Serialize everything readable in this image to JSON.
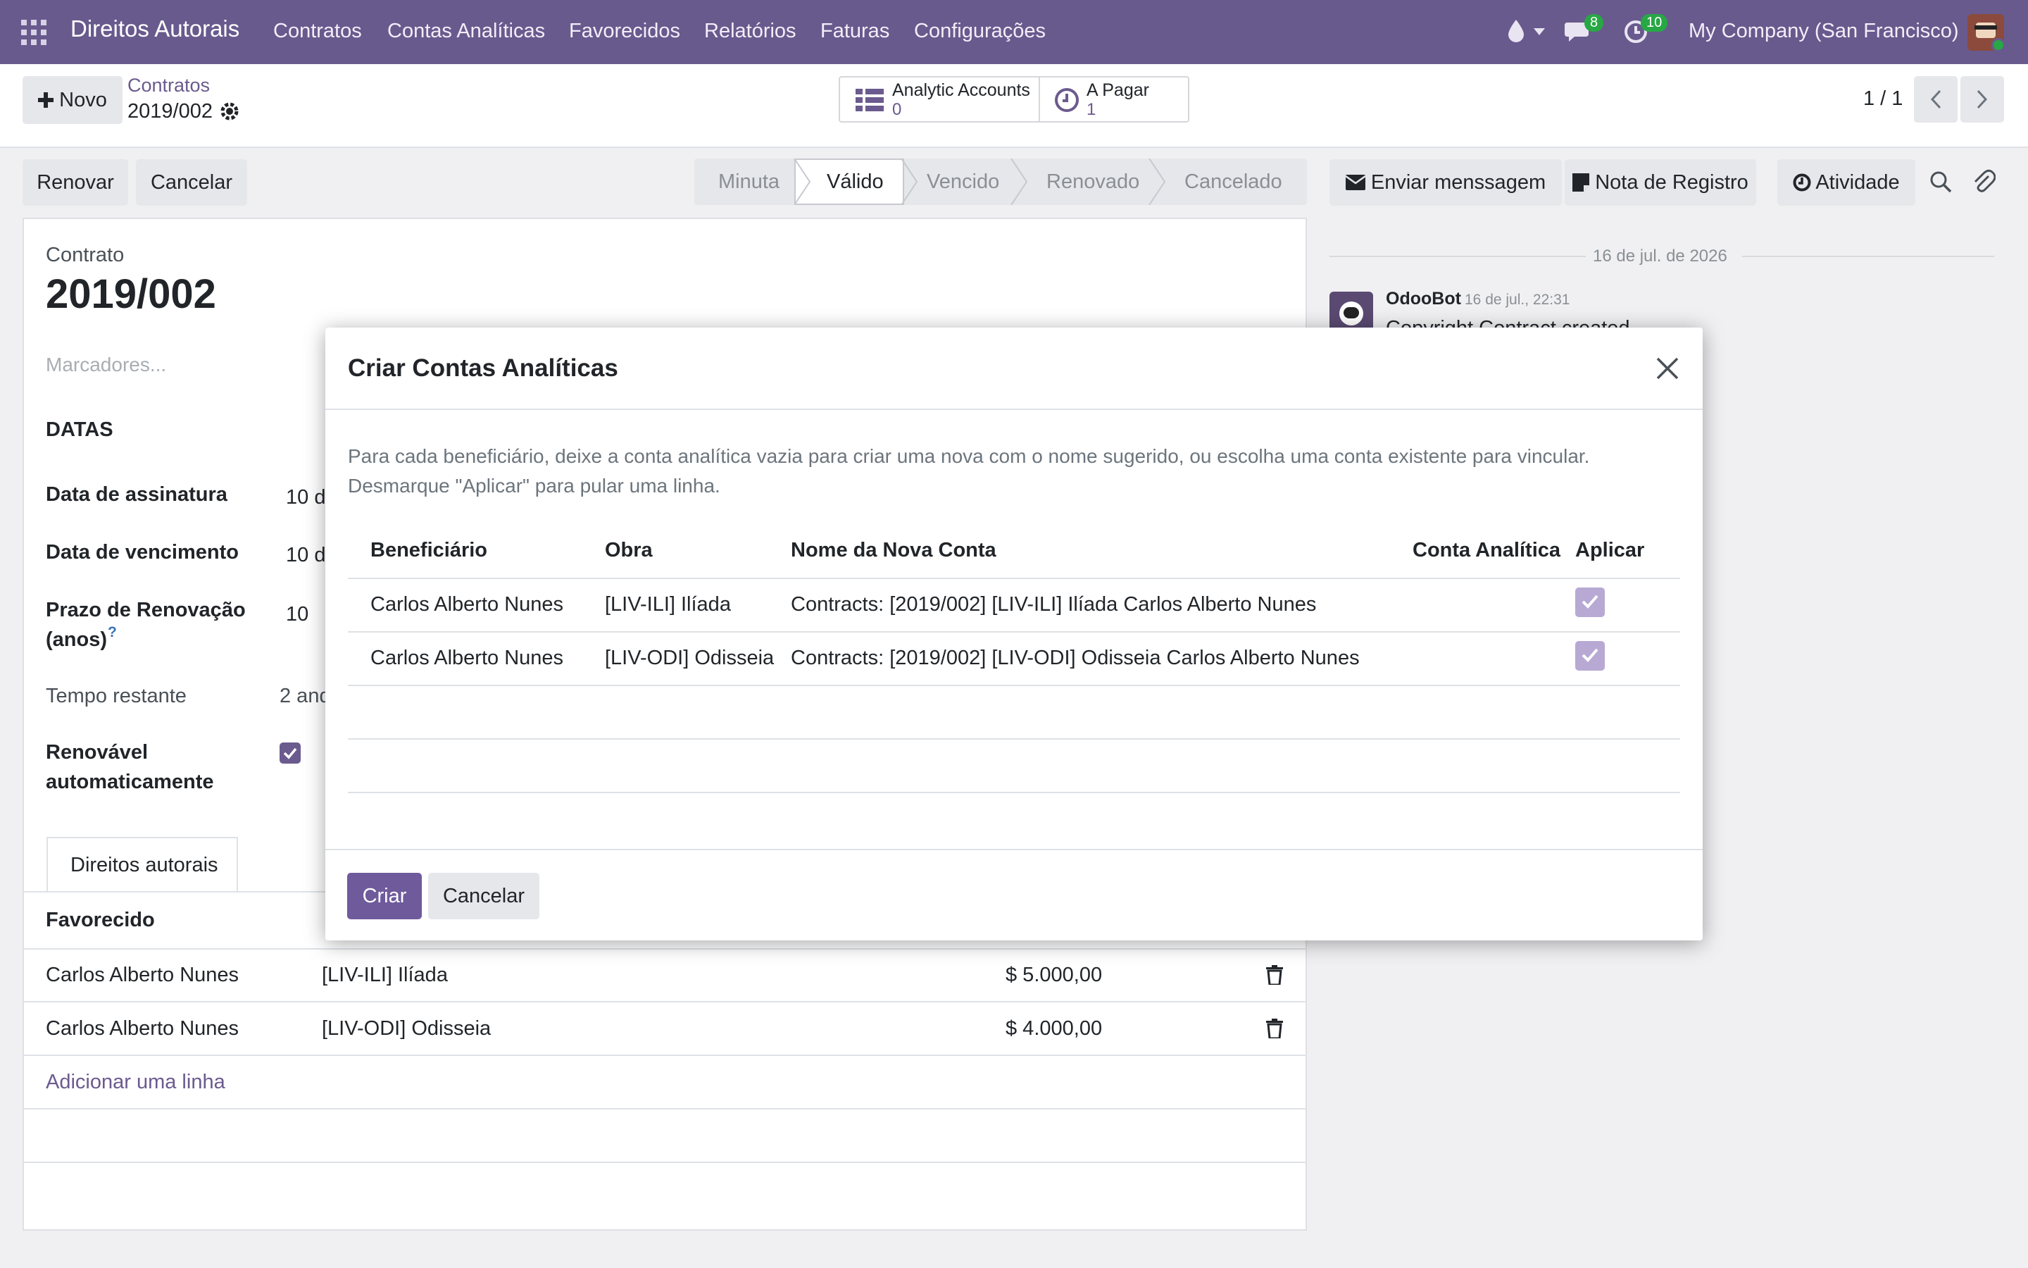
{
  "navbar": {
    "brand": "Direitos Autorais",
    "menu": [
      "Contratos",
      "Contas Analíticas",
      "Favorecidos",
      "Relatórios",
      "Faturas",
      "Configurações"
    ],
    "messages_count": "8",
    "activities_count": "10",
    "company": "My Company (San Francisco)"
  },
  "control": {
    "new_button": "Novo",
    "breadcrumb_parent": "Contratos",
    "breadcrumb_current": "2019/002",
    "smart_buttons": [
      {
        "label": "Analytic Accounts",
        "value": "0"
      },
      {
        "label": "A Pagar",
        "value": "1"
      }
    ],
    "pager": "1 / 1"
  },
  "actions": {
    "renew": "Renovar",
    "cancel": "Cancelar"
  },
  "stages": [
    "Minuta",
    "Válido",
    "Vencido",
    "Renovado",
    "Cancelado"
  ],
  "active_stage": "Válido",
  "chatter": {
    "send_message": "Enviar menssagem",
    "log_note": "Nota de Registro",
    "activity": "Atividade",
    "date_separator": "16 de jul. de 2026",
    "author": "OdooBot",
    "time": "16 de jul., 22:31",
    "message": "Copyright Contract created"
  },
  "form": {
    "contract_label": "Contrato",
    "contract_name": "2019/002",
    "tags_placeholder": "Marcadores...",
    "section_dates": "DATAS",
    "signature_date_label": "Data de assinatura",
    "signature_date_value": "10 d",
    "expiry_date_label": "Data de vencimento",
    "expiry_date_value": "10 d",
    "renewal_term_label_1": "Prazo de Renovação",
    "renewal_term_label_2": "(anos)",
    "renewal_term_value": "10",
    "remaining_label": "Tempo restante",
    "remaining_value": "2 and",
    "auto_renew_label_1": "Renovável",
    "auto_renew_label_2": "automaticamente",
    "tab": "Direitos autorais",
    "lines_header": "Favorecido",
    "lines": [
      {
        "payee": "Carlos Alberto Nunes",
        "work": "[LIV-ILI] Ilíada",
        "amount": "$ 5.000,00"
      },
      {
        "payee": "Carlos Alberto Nunes",
        "work": "[LIV-ODI] Odisseia",
        "amount": "$ 4.000,00"
      }
    ],
    "add_line": "Adicionar uma linha"
  },
  "modal": {
    "title": "Criar Contas Analíticas",
    "description_line1": "Para cada beneficiário, deixe a conta analítica vazia para criar uma nova com o nome sugerido, ou escolha uma conta existente para vincular.",
    "description_line2": "Desmarque \"Aplicar\" para pular uma linha.",
    "columns": [
      "Beneficiário",
      "Obra",
      "Nome da Nova Conta",
      "Conta Analítica",
      "Aplicar"
    ],
    "rows": [
      {
        "beneficiary": "Carlos Alberto Nunes",
        "work": "[LIV-ILI] Ilíada",
        "new_account": "Contracts: [2019/002] [LIV-ILI] Ilíada Carlos Alberto Nunes",
        "analytic_account": "",
        "apply": true
      },
      {
        "beneficiary": "Carlos Alberto Nunes",
        "work": "[LIV-ODI] Odisseia",
        "new_account": "Contracts: [2019/002] [LIV-ODI] Odisseia Carlos Alberto Nunes",
        "analytic_account": "",
        "apply": true
      }
    ],
    "create_button": "Criar",
    "cancel_button": "Cancelar"
  },
  "colors": {
    "navbar": "#685a8d",
    "primary": "#6f5a9b",
    "badge": "#28a745"
  }
}
